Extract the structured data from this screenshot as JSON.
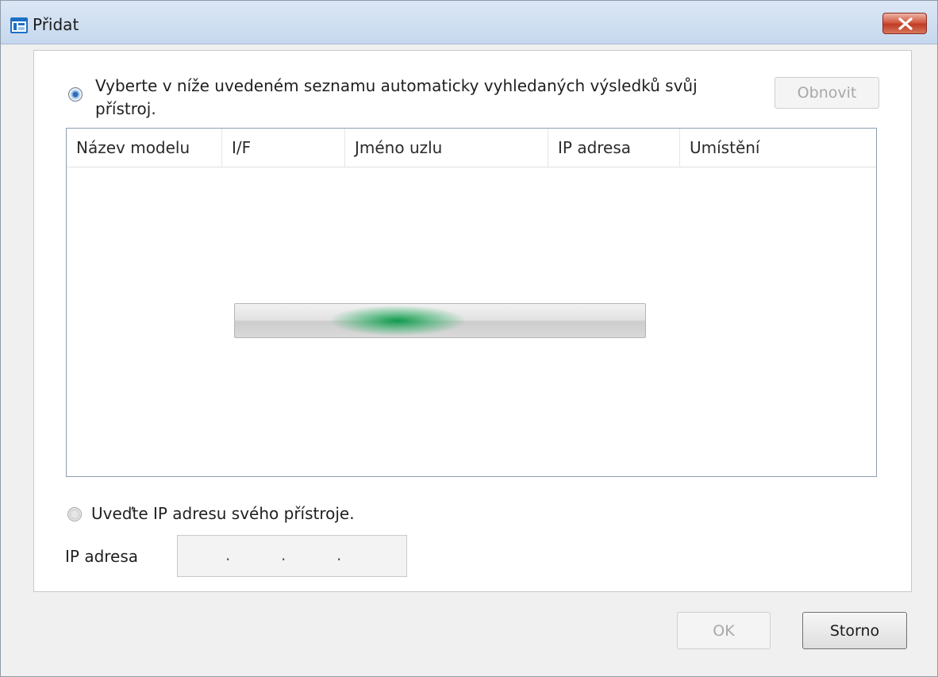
{
  "window": {
    "title": "Přidat",
    "close_icon": "close-icon"
  },
  "auto_search": {
    "radio_selected": true,
    "label": "Vyberte v níže uvedeném seznamu automaticky vyhledaných výsledků svůj přístroj.",
    "refresh_button": "Obnovit"
  },
  "device_list": {
    "columns": [
      "Název modelu",
      "I/F",
      "Jméno uzlu",
      "IP adresa",
      "Umístění"
    ],
    "rows": [],
    "searching": true
  },
  "manual_ip": {
    "radio_selected": false,
    "label": "Uveďte IP adresu svého přístroje.",
    "field_label": "IP adresa",
    "octets": [
      "",
      "",
      "",
      ""
    ]
  },
  "buttons": {
    "ok": "OK",
    "cancel": "Storno"
  },
  "colors": {
    "progress_accent": "#069646",
    "close_button": "#c03b24",
    "titlebar": "#c6d8ee"
  }
}
